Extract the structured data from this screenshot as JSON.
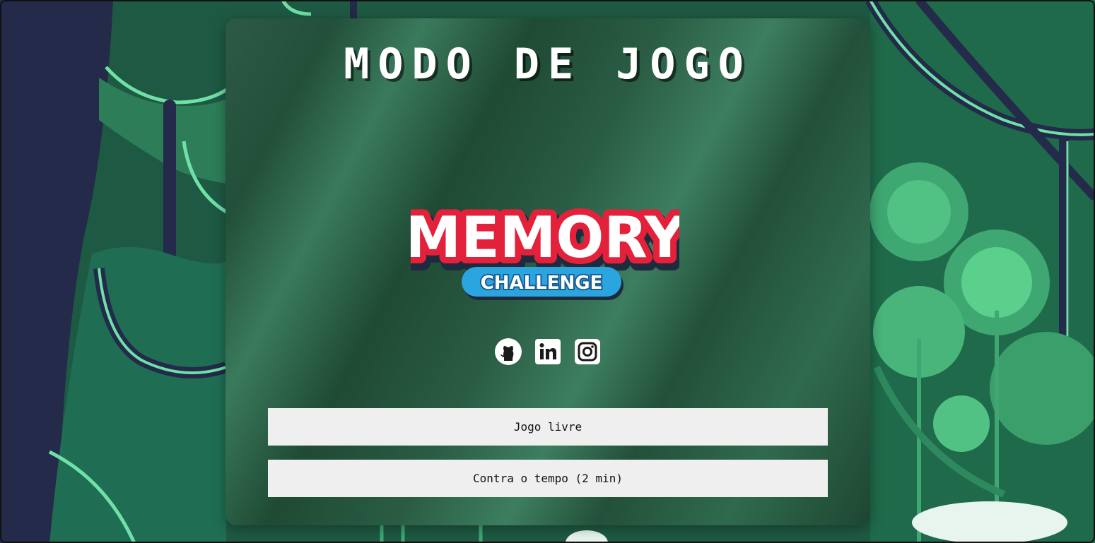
{
  "title": "MODO DE JOGO",
  "logo": {
    "line1": "MEMORY",
    "line2": "CHALLENGE"
  },
  "socials": [
    {
      "icon": "github-icon"
    },
    {
      "icon": "linkedin-icon"
    },
    {
      "icon": "instagram-icon"
    }
  ],
  "buttons": {
    "free_play": "Jogo livre",
    "timed": "Contra o tempo (2 min)"
  },
  "colors": {
    "panel": "#2c5a44",
    "button_bg": "#efefef",
    "logo_red": "#e3213a",
    "logo_blue": "#2aa5e0"
  }
}
